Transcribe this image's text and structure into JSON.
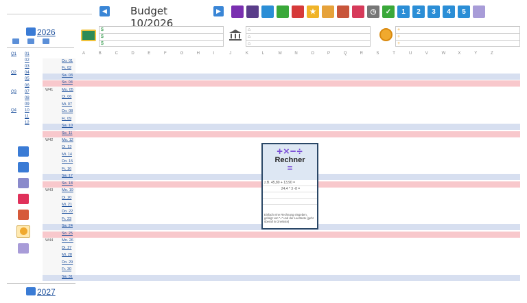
{
  "header": {
    "title": "Budget 10/2026",
    "prev_icon": "arrow-left-icon",
    "next_icon": "arrow-right-icon",
    "toolbar_icons": [
      {
        "name": "person-icon",
        "color": "#7a2fb0",
        "label": ""
      },
      {
        "name": "book-dark-icon",
        "color": "#5a3d8a",
        "label": ""
      },
      {
        "name": "book-blue-icon",
        "color": "#2b8ed6",
        "label": ""
      },
      {
        "name": "book-green-icon",
        "color": "#3aa83a",
        "label": ""
      },
      {
        "name": "book-red-icon",
        "color": "#d63a3a",
        "label": ""
      },
      {
        "name": "star-icon",
        "color": "#f0b429",
        "label": "★"
      },
      {
        "name": "lock-icon",
        "color": "#e6a23a",
        "label": ""
      },
      {
        "name": "house-icon",
        "color": "#c8553a",
        "label": ""
      },
      {
        "name": "lock-red-icon",
        "color": "#d63a5a",
        "label": ""
      },
      {
        "name": "clock-icon",
        "color": "#777777",
        "label": "◷"
      },
      {
        "name": "check-icon",
        "color": "#3aa83a",
        "label": "✓"
      },
      {
        "name": "page-1-icon",
        "color": "#2b8ed6",
        "label": "1"
      },
      {
        "name": "page-2-icon",
        "color": "#2b8ed6",
        "label": "2"
      },
      {
        "name": "page-3-icon",
        "color": "#2b8ed6",
        "label": "3"
      },
      {
        "name": "page-4-icon",
        "color": "#2b8ed6",
        "label": "4"
      },
      {
        "name": "page-5-icon",
        "color": "#2b8ed6",
        "label": "5"
      },
      {
        "name": "book-open-icon",
        "color": "#a89cd8",
        "label": ""
      }
    ]
  },
  "year": {
    "label": "2026",
    "next_label": "2027"
  },
  "inputs": {
    "cash": [
      "$",
      "$",
      "$"
    ],
    "bank": [
      "⌂",
      "⌂",
      "⌂"
    ],
    "coin": [
      "+",
      "+",
      "+"
    ]
  },
  "sidebar": {
    "quarters": [
      "Q1",
      "Q2",
      "Q3",
      "Q4"
    ],
    "months": [
      "01",
      "02",
      "03",
      "04",
      "05",
      "06",
      "07",
      "08",
      "09",
      "10",
      "11",
      "12"
    ]
  },
  "columns": [
    "A",
    "B",
    "C",
    "D",
    "E",
    "F",
    "G",
    "H",
    "I",
    "J",
    "K",
    "L",
    "M",
    "N",
    "O",
    "P",
    "Q",
    "R",
    "S",
    "T",
    "U",
    "V",
    "W",
    "X",
    "Y",
    "Z"
  ],
  "days": [
    {
      "week": "",
      "day": "Do. 01",
      "type": ""
    },
    {
      "week": "",
      "day": "Fr. 02",
      "type": ""
    },
    {
      "week": "",
      "day": "Sa. 03",
      "type": "sat"
    },
    {
      "week": "",
      "day": "So. 04",
      "type": "sun"
    },
    {
      "week": "W41",
      "day": "Mo. 05",
      "type": ""
    },
    {
      "week": "",
      "day": "Di. 06",
      "type": ""
    },
    {
      "week": "",
      "day": "Mi. 07",
      "type": ""
    },
    {
      "week": "",
      "day": "Do. 08",
      "type": ""
    },
    {
      "week": "",
      "day": "Fr. 09",
      "type": ""
    },
    {
      "week": "",
      "day": "Sa. 10",
      "type": "sat"
    },
    {
      "week": "",
      "day": "So. 11",
      "type": "sun"
    },
    {
      "week": "W42",
      "day": "Mo. 12",
      "type": ""
    },
    {
      "week": "",
      "day": "Di. 13",
      "type": ""
    },
    {
      "week": "",
      "day": "Mi. 14",
      "type": ""
    },
    {
      "week": "",
      "day": "Do. 15",
      "type": ""
    },
    {
      "week": "",
      "day": "Fr. 16",
      "type": ""
    },
    {
      "week": "",
      "day": "Sa. 17",
      "type": "sat"
    },
    {
      "week": "",
      "day": "So. 18",
      "type": "sun"
    },
    {
      "week": "W43",
      "day": "Mo. 19",
      "type": ""
    },
    {
      "week": "",
      "day": "Di. 20",
      "type": ""
    },
    {
      "week": "",
      "day": "Mi. 21",
      "type": ""
    },
    {
      "week": "",
      "day": "Do. 22",
      "type": ""
    },
    {
      "week": "",
      "day": "Fr. 23",
      "type": ""
    },
    {
      "week": "",
      "day": "Sa. 24",
      "type": "sat"
    },
    {
      "week": "",
      "day": "So. 25",
      "type": "sun"
    },
    {
      "week": "W44",
      "day": "Mo. 26",
      "type": ""
    },
    {
      "week": "",
      "day": "Di. 27",
      "type": ""
    },
    {
      "week": "",
      "day": "Mi. 28",
      "type": ""
    },
    {
      "week": "",
      "day": "Do. 29",
      "type": ""
    },
    {
      "week": "",
      "day": "Fr. 30",
      "type": ""
    },
    {
      "week": "",
      "day": "Sa. 31",
      "type": "sat"
    }
  ],
  "side_icons": [
    {
      "name": "calendar-icon",
      "color": "#3a7bd5"
    },
    {
      "name": "calendar-alt-icon",
      "color": "#3a7bd5"
    },
    {
      "name": "edit-note-icon",
      "color": "#8a8acb"
    },
    {
      "name": "heart-icon",
      "color": "#e0315a"
    },
    {
      "name": "runner-icon",
      "color": "#d65a3a"
    },
    {
      "name": "coin-stack-icon",
      "color": "#f0a92e"
    },
    {
      "name": "notebook-icon",
      "color": "#a89cd8"
    }
  ],
  "calculator": {
    "ops": "+×−÷",
    "title": "Rechner",
    "eq": "=",
    "example1": "z.B. 45,80 + 13,90 =",
    "example2": "24,4 * 3 -8 =",
    "footer": "Einfach eine Rechnung eingeben, gefolgt von \"=\" und der Leertaste (geht überall in OneNote)"
  }
}
